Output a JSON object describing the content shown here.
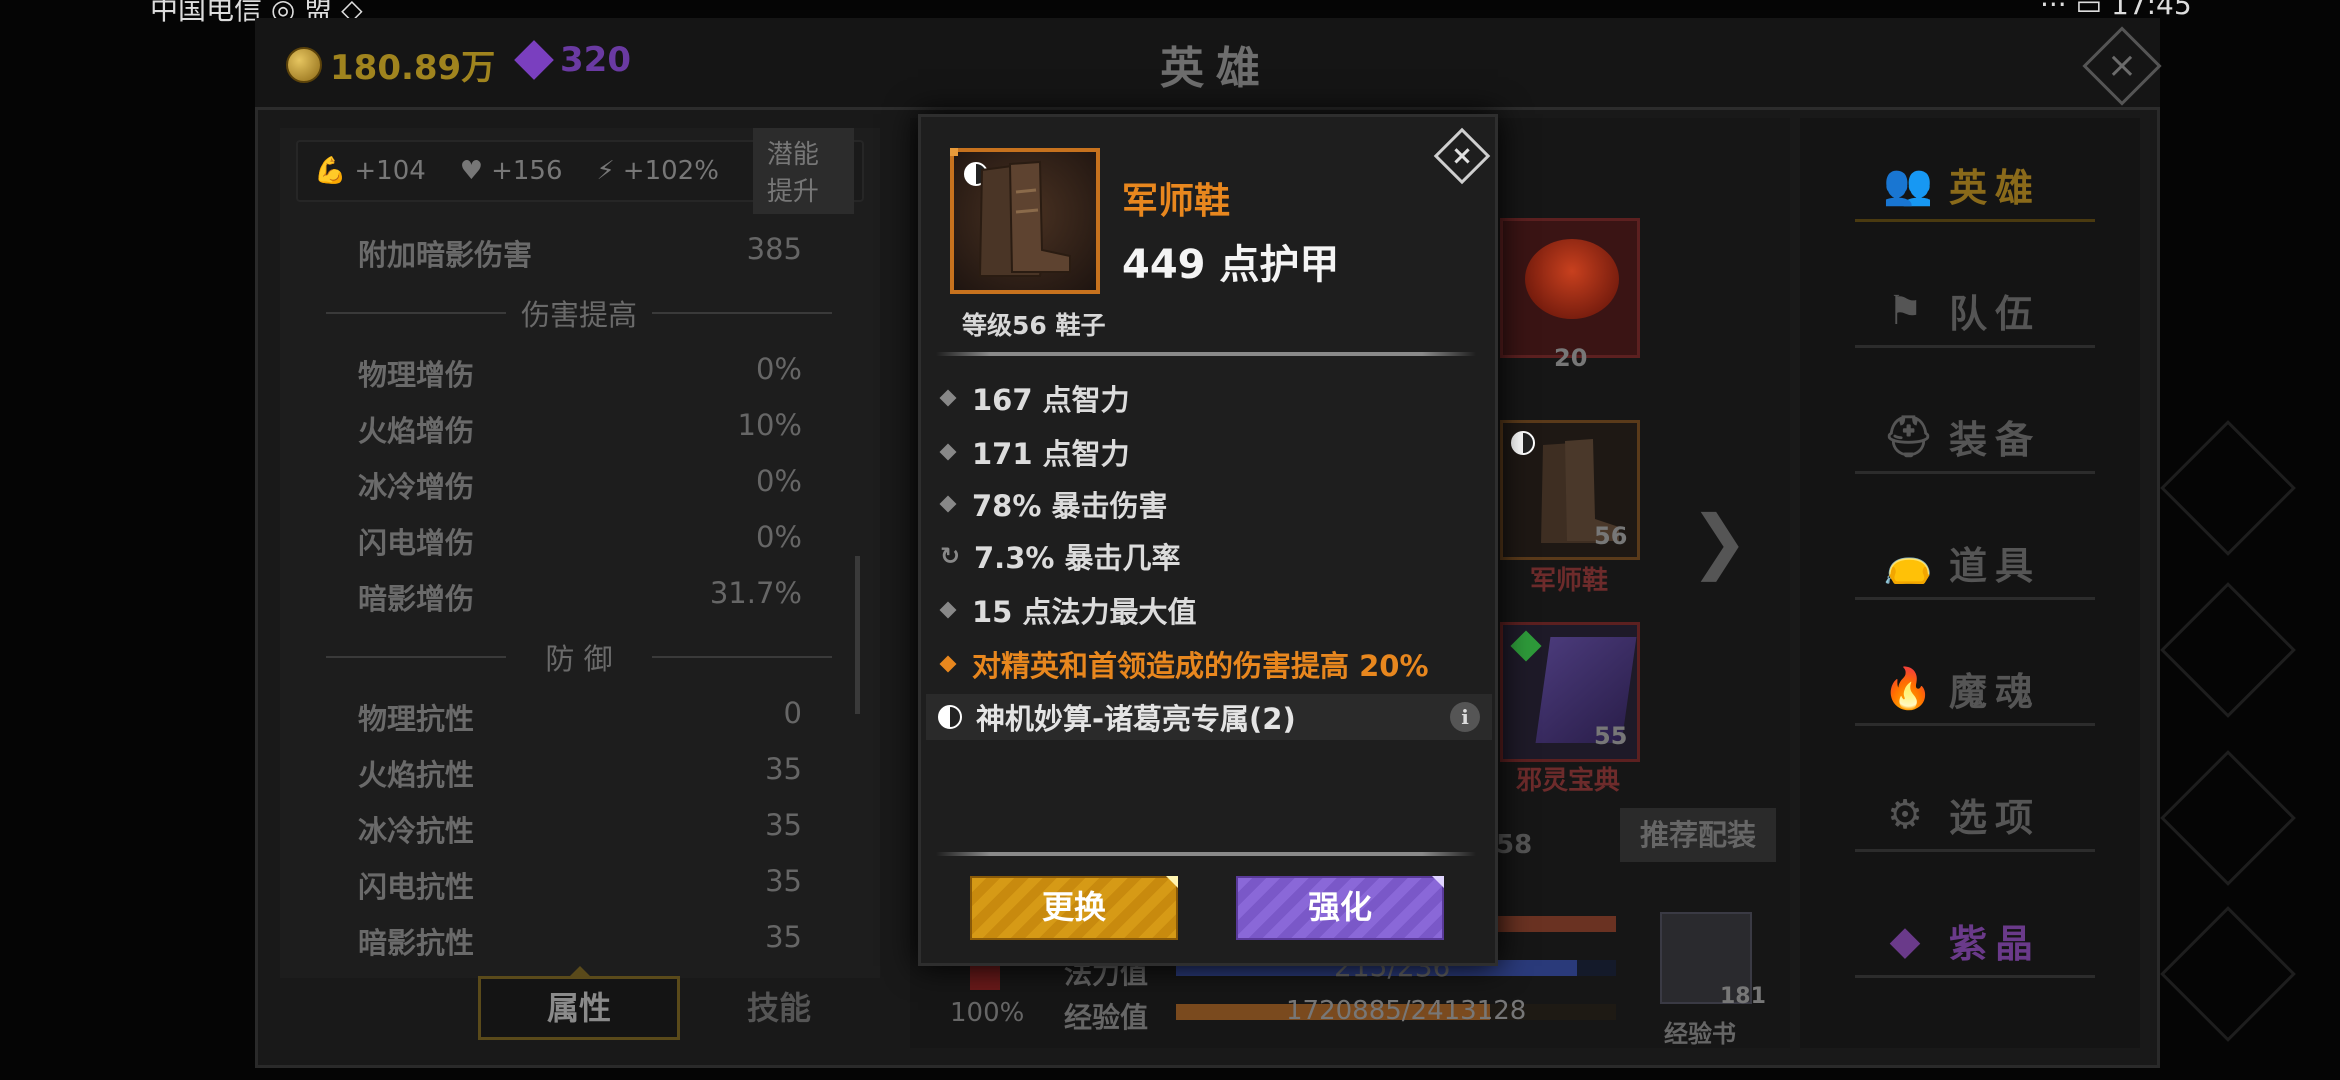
{
  "status_bar": {
    "left_text": "中国电信 ◎ 盟 ◇",
    "right_text": "··· ▭ 17:45"
  },
  "currency": {
    "gold": "180.89万",
    "gems": "320"
  },
  "screen_title": "英雄",
  "buffs": [
    {
      "icon": "strength-icon",
      "value": "+104"
    },
    {
      "icon": "heart-icon",
      "value": "+156"
    },
    {
      "icon": "lightning-icon",
      "value": "+102%"
    }
  ],
  "potential_button": "潜能提升",
  "stats_top": [
    {
      "label": "附加暗影伤害",
      "value": "385"
    }
  ],
  "section_damage": "伤害提高",
  "damage_stats": [
    {
      "label": "物理增伤",
      "value": "0%"
    },
    {
      "label": "火焰增伤",
      "value": "10%"
    },
    {
      "label": "冰冷增伤",
      "value": "0%"
    },
    {
      "label": "闪电增伤",
      "value": "0%"
    },
    {
      "label": "暗影增伤",
      "value": "31.7%"
    }
  ],
  "section_defense": "防 御",
  "defense_stats": [
    {
      "label": "物理抗性",
      "value": "0"
    },
    {
      "label": "火焰抗性",
      "value": "35"
    },
    {
      "label": "冰冷抗性",
      "value": "35"
    },
    {
      "label": "闪电抗性",
      "value": "35"
    },
    {
      "label": "暗影抗性",
      "value": "35"
    }
  ],
  "tabs": {
    "attributes": "属性",
    "skills": "技能"
  },
  "background": {
    "pet_level": "20",
    "boots_level": "56",
    "boots_name": "军师鞋",
    "book_level": "55",
    "book_name": "邪灵宝典",
    "partial_number": "58",
    "recommend": "推荐配装",
    "mana_label": "法力值",
    "mana_value": "215/236",
    "exp_label": "经验值",
    "exp_value": "1720885/2413128",
    "exp_fraction": 0.713,
    "mana_fraction": 0.911,
    "crit_pct": "100%",
    "exp_book_label": "经验书",
    "exp_book_count": "181"
  },
  "nav": [
    {
      "icon": "hero-icon",
      "glyph": "👥",
      "label": "英雄",
      "active": true
    },
    {
      "icon": "flag-icon",
      "glyph": "⚑",
      "label": "队伍"
    },
    {
      "icon": "helmet-icon",
      "glyph": "⛑",
      "label": "装备"
    },
    {
      "icon": "bag-icon",
      "glyph": "👝",
      "label": "道具"
    },
    {
      "icon": "flame-icon",
      "glyph": "🔥",
      "label": "魔魂"
    },
    {
      "icon": "gear-icon",
      "glyph": "⚙",
      "label": "选项"
    },
    {
      "icon": "gem-icon",
      "glyph": "◆",
      "label": "紫晶"
    }
  ],
  "tooltip": {
    "item_name": "军师鞋",
    "armor": "449 点护甲",
    "level_type": "等级56 鞋子",
    "affixes": [
      {
        "text": "167 点智力",
        "kind": "normal"
      },
      {
        "text": "171 点智力",
        "kind": "normal"
      },
      {
        "text": "78% 暴击伤害",
        "kind": "normal"
      },
      {
        "text": "7.3% 暴击几率",
        "kind": "reroll"
      },
      {
        "text": "15 点法力最大值",
        "kind": "normal"
      },
      {
        "text": "对精英和首领造成的伤害提高 20%",
        "kind": "legendary"
      }
    ],
    "set_bonus": "神机妙算-诸葛亮专属(2)",
    "swap_button": "更换",
    "upgrade_button": "强化"
  },
  "colors": {
    "legendary": "#e8871e",
    "accent_gold": "#c7721e",
    "upgrade_purple": "#8a68d8"
  }
}
